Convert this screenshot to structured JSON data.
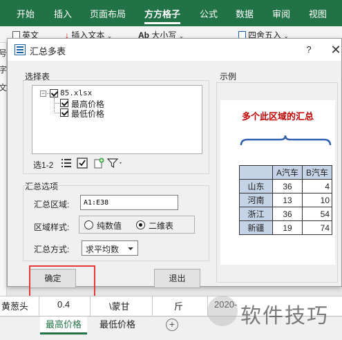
{
  "ribbon": {
    "tabs": [
      "开始",
      "插入",
      "页面布局",
      "方方格子",
      "公式",
      "数据",
      "审阅",
      "视图"
    ],
    "active_tab": "方方格子"
  },
  "toolbar": {
    "english_label": "英文",
    "insert_text_label": "插入文本",
    "case_label": "大小写",
    "rounding_label": "四舍五入"
  },
  "left_strip_chars": [
    "号",
    "字",
    "文"
  ],
  "dialog": {
    "title": "汇总多表",
    "help": "?",
    "select_table_label": "选择表",
    "tree": {
      "file": "85.xlsx",
      "sheets": [
        "最高价格",
        "最低价格"
      ]
    },
    "select_range_label": "选1-2",
    "summary_options_label": "汇总选项",
    "range_label": "汇总区域:",
    "range_value": "A1:E38",
    "style_label": "区域样式:",
    "style_options": [
      "纯数值",
      "二维表"
    ],
    "style_selected": "二维表",
    "method_label": "汇总方式:",
    "method_value": "求平均数",
    "ok_label": "确定",
    "exit_label": "退出",
    "example_label": "示例",
    "example": {
      "title": "多个此区域的汇总",
      "headers": [
        "",
        "A汽车",
        "B汽车"
      ],
      "rows": [
        [
          "山东",
          "36",
          "4"
        ],
        [
          "河南",
          "13",
          "10"
        ],
        [
          "浙江",
          "36",
          "54"
        ],
        [
          "新疆",
          "19",
          "74"
        ]
      ]
    }
  },
  "sheet": {
    "row_cells": [
      "黄葱头",
      "0.4",
      "\\蒙甘",
      "斤",
      "2020-"
    ],
    "tabs": [
      "最高价格",
      "最低价格"
    ],
    "active_tab": "最高价格",
    "add_tab": "+"
  },
  "watermark": "软件技巧",
  "colors": {
    "excel_green": "#217346",
    "highlight_red": "#e53935",
    "example_title_red": "#c00000"
  }
}
